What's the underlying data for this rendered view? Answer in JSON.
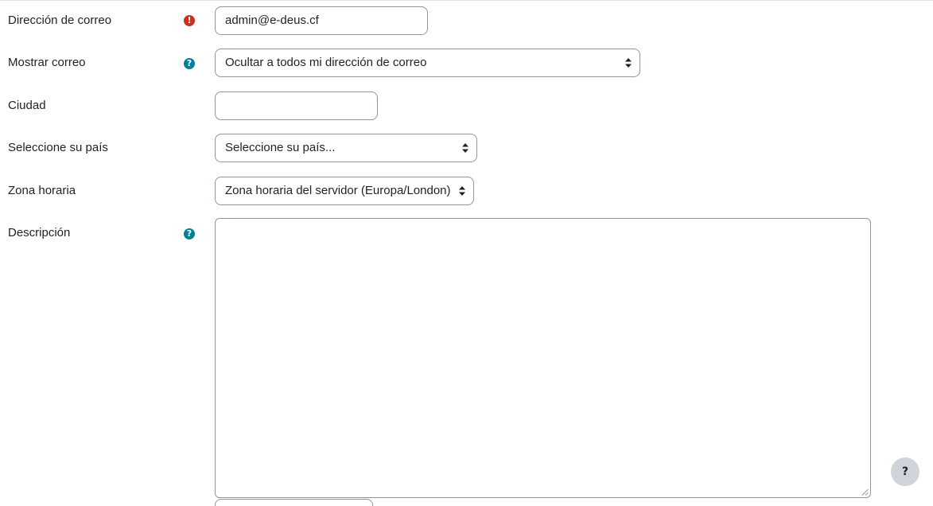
{
  "form": {
    "email": {
      "label": "Dirección de correo",
      "value": "admin@e-deus.cf",
      "icon": "required-icon",
      "icon_glyph": "!"
    },
    "display_email": {
      "label": "Mostrar correo",
      "selected": "Ocultar a todos mi dirección de correo",
      "icon": "help-icon",
      "icon_glyph": "?"
    },
    "city": {
      "label": "Ciudad",
      "value": ""
    },
    "country": {
      "label": "Seleccione su país",
      "selected": "Seleccione su país..."
    },
    "timezone": {
      "label": "Zona horaria",
      "selected": "Zona horaria del servidor (Europa/London)"
    },
    "description": {
      "label": "Descripción",
      "value": "",
      "icon": "help-icon",
      "icon_glyph": "?"
    }
  },
  "help_button": {
    "glyph": "?"
  },
  "colors": {
    "required": "#ca3120",
    "help": "#008196",
    "border": "#8f959e",
    "text": "#1d2125",
    "fab": "#ced4da"
  }
}
